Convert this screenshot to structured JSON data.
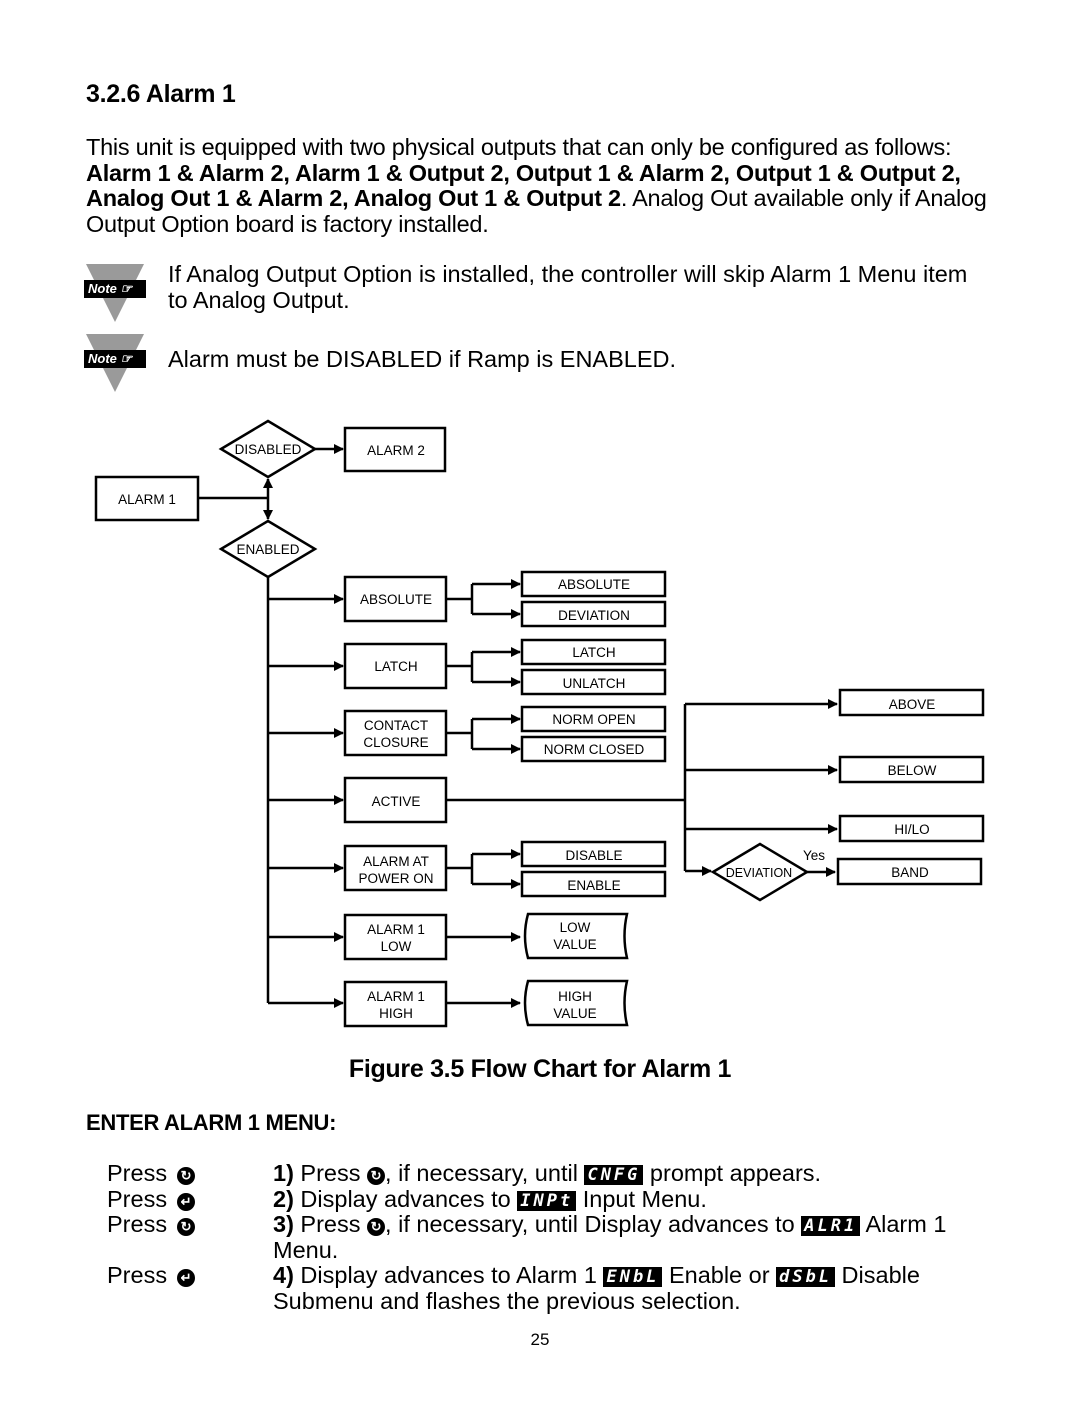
{
  "section": {
    "title": "3.2.6 Alarm 1",
    "intro": {
      "part1": "This unit is equipped with two physical outputs that can only be configured as follows: ",
      "bold": "Alarm 1 & Alarm 2, Alarm 1 & Output 2, Output 1 & Alarm 2, Output 1 & Output 2, Analog Out 1 & Alarm 2, Analog Out 1 & Output 2",
      "part2": ". Analog Out available only if Analog Output Option board is factory installed."
    }
  },
  "notes": [
    {
      "badge": "Note ☞",
      "text": "If Analog Output Option is installed, the controller will skip Alarm 1 Menu item to Analog Output."
    },
    {
      "badge": "Note ☞",
      "text": "Alarm must be DISABLED if Ramp is ENABLED."
    }
  ],
  "flowchart": {
    "alarm1": "ALARM 1",
    "disabled": "DISABLED",
    "alarm2": "ALARM 2",
    "enabled": "ENABLED",
    "absolute": "ABSOLUTE",
    "absolute_opt": "ABSOLUTE",
    "deviation_opt": "DEVIATION",
    "latch": "LATCH",
    "latch_opt": "LATCH",
    "unlatch_opt": "UNLATCH",
    "contact_l1": "CONTACT",
    "contact_l2": "CLOSURE",
    "norm_open": "NORM OPEN",
    "norm_closed": "NORM CLOSED",
    "active": "ACTIVE",
    "above": "ABOVE",
    "below": "BELOW",
    "hilo": "HI/LO",
    "deviation_dec": "DEVIATION",
    "yes": "Yes",
    "band": "BAND",
    "power_l1": "ALARM AT",
    "power_l2": "POWER ON",
    "disable_opt": "DISABLE",
    "enable_opt": "ENABLE",
    "low_l1": "ALARM 1",
    "low_l2": "LOW",
    "lowval_l1": "LOW",
    "lowval_l2": "VALUE",
    "high_l1": "ALARM 1",
    "high_l2": "HIGH",
    "highval_l1": "HIGH",
    "highval_l2": "VALUE"
  },
  "figure_caption": "Figure 3.5 Flow Chart for Alarm 1",
  "menu": {
    "heading": "ENTER ALARM 1 MENU:",
    "press_label": "Press",
    "steps": [
      {
        "button": "scroll-icon",
        "num": "1)",
        "t1": " Press ",
        "t2": ", if necessary, until ",
        "lcd": "CNFG",
        "t3": " prompt appears."
      },
      {
        "button": "enter-icon",
        "num": "2)",
        "t1": " Display advances to ",
        "lcd": "INPt",
        "t2": " Input Menu."
      },
      {
        "button": "scroll-icon",
        "num": "3)",
        "t1": " Press ",
        "t2": ", if necessary, until Display advances to ",
        "lcd": "ALR1",
        "t3": " Alarm 1 Menu."
      },
      {
        "button": "enter-icon",
        "num": "4)",
        "t1": " Display advances to Alarm 1 ",
        "lcd": "ENbL",
        "t2": " Enable or ",
        "lcd2": "dSbL",
        "t3": " Disable Submenu and flashes the previous selection."
      }
    ]
  },
  "page_number": "25"
}
